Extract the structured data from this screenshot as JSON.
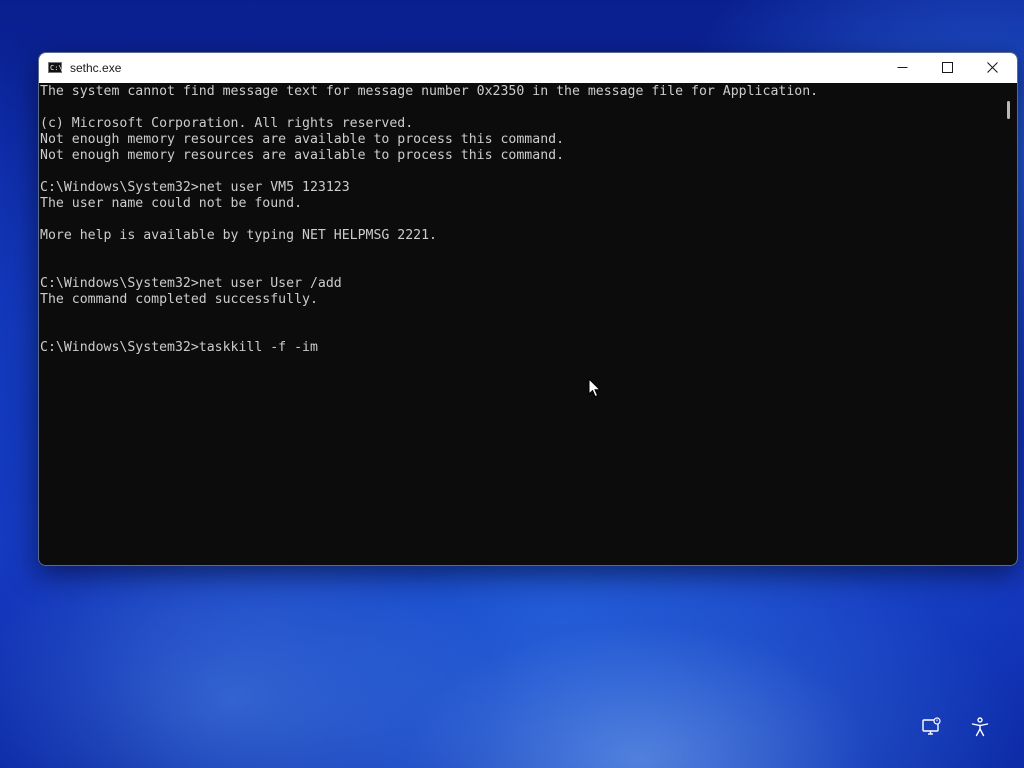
{
  "window": {
    "title": "sethc.exe",
    "icon": "C:\\",
    "controls": {
      "minimize": "minimize-icon",
      "maximize": "maximize-icon",
      "close": "close-icon"
    }
  },
  "console": {
    "lines": [
      "The system cannot find message text for message number 0x2350 in the message file for Application.",
      "",
      "(c) Microsoft Corporation. All rights reserved.",
      "Not enough memory resources are available to process this command.",
      "Not enough memory resources are available to process this command.",
      "",
      "C:\\Windows\\System32>net user VM5 123123",
      "The user name could not be found.",
      "",
      "More help is available by typing NET HELPMSG 2221.",
      "",
      "",
      "C:\\Windows\\System32>net user User /add",
      "The command completed successfully.",
      "",
      "",
      "C:\\Windows\\System32>taskkill -f -im"
    ]
  },
  "tray": {
    "remote_icon": "remote-display-icon",
    "accessibility_icon": "accessibility-icon"
  },
  "colors": {
    "console_bg": "#0c0c0c",
    "console_text": "#cccccc",
    "title_bar": "#ffffff"
  }
}
